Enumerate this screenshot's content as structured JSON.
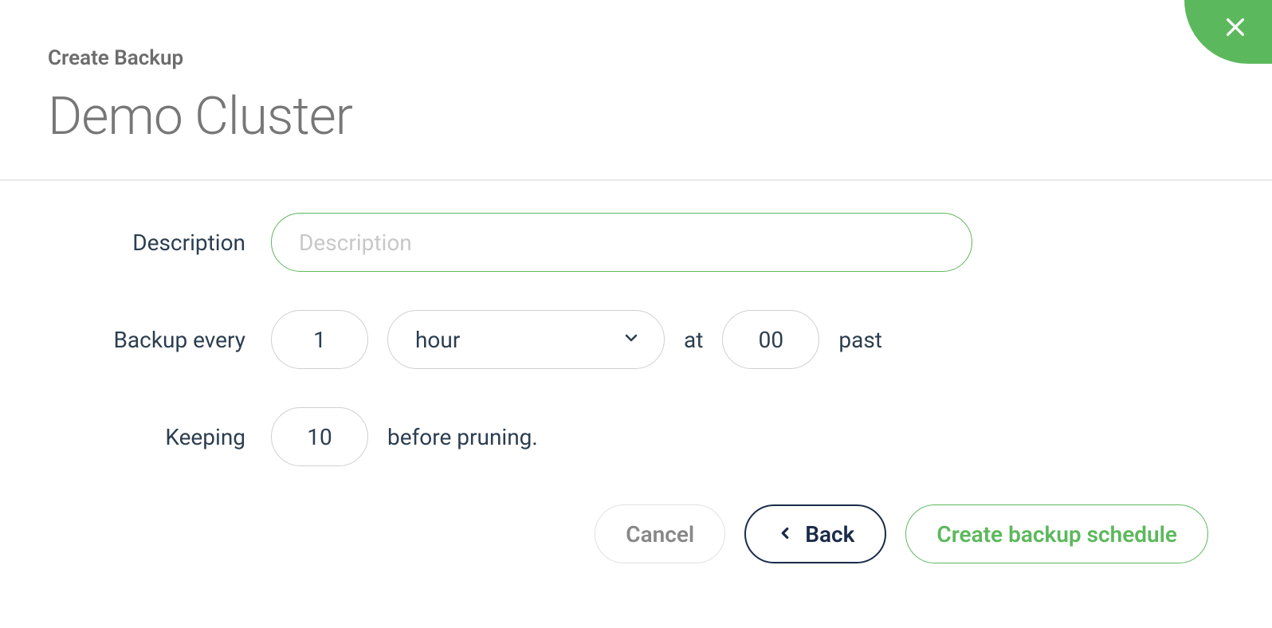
{
  "header": {
    "subtitle": "Create Backup",
    "title": "Demo Cluster"
  },
  "form": {
    "description": {
      "label": "Description",
      "placeholder": "Description",
      "value": ""
    },
    "backup_every": {
      "label": "Backup every",
      "interval_value": "1",
      "unit_selected": "hour",
      "at_text": "at",
      "minute_value": "00",
      "past_text": "past"
    },
    "keeping": {
      "label": "Keeping",
      "value": "10",
      "suffix_text": "before pruning."
    }
  },
  "buttons": {
    "cancel": "Cancel",
    "back": "Back",
    "create": "Create backup schedule"
  }
}
